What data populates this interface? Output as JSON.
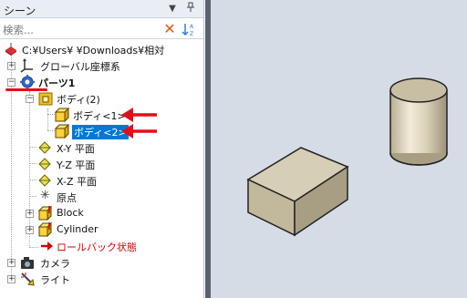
{
  "panel": {
    "title": "シーン",
    "pin_icon": "pin-icon",
    "dropdown_icon": "chevron-down-icon"
  },
  "search": {
    "placeholder": "検索...",
    "clear_icon": "close-icon",
    "sort_icon": "sort-icon"
  },
  "tree": {
    "root": "C:¥Users¥           ¥Downloads¥相対",
    "global_coords": "グローバル座標系",
    "part": "パーツ1",
    "bodies_folder": "ボディ(2)",
    "body1": "ボディ<1>",
    "body2": "ボディ<2>",
    "plane_xy": "X-Y 平面",
    "plane_yz": "Y-Z 平面",
    "plane_xz": "X-Z 平面",
    "origin": "原点",
    "feature_block": "Block",
    "feature_cylinder": "Cylinder",
    "rollback": "ロールバック状態",
    "camera": "カメラ",
    "light": "ライト"
  },
  "colors": {
    "accent_selection": "#0078d7",
    "annotation_red": "#e0101a",
    "viewport_bg": "#d6dce6",
    "solid_fill": "#c9bfa6"
  }
}
